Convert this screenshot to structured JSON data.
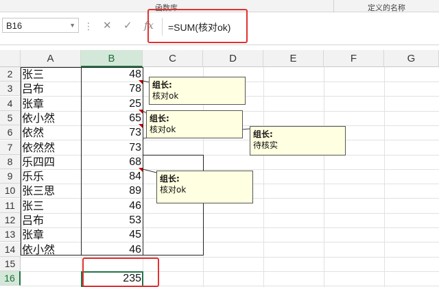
{
  "ribbon": {
    "group_functions": "函数库",
    "group_names": "定义的名称"
  },
  "namebox": {
    "value": "B16"
  },
  "formula": {
    "text": "=SUM(核对ok)",
    "fx_symbol": "fx",
    "cancel_symbol": "✕",
    "enter_symbol": "✓"
  },
  "columns": [
    "A",
    "B",
    "C",
    "D",
    "E",
    "F",
    "G"
  ],
  "rows": [
    {
      "num": "2",
      "name": "张三",
      "value": "48"
    },
    {
      "num": "3",
      "name": "吕布",
      "value": "78"
    },
    {
      "num": "4",
      "name": "张章",
      "value": "25"
    },
    {
      "num": "5",
      "name": "依小然",
      "value": "65"
    },
    {
      "num": "6",
      "name": "依然",
      "value": "73"
    },
    {
      "num": "7",
      "name": "依然然",
      "value": "73"
    },
    {
      "num": "8",
      "name": "乐四四",
      "value": "68"
    },
    {
      "num": "9",
      "name": "乐乐",
      "value": "84"
    },
    {
      "num": "10",
      "name": "张三思",
      "value": "89"
    },
    {
      "num": "11",
      "name": "张三",
      "value": "46"
    },
    {
      "num": "12",
      "name": "吕布",
      "value": "53"
    },
    {
      "num": "13",
      "name": "张章",
      "value": "45"
    },
    {
      "num": "14",
      "name": "依小然",
      "value": "46"
    },
    {
      "num": "15",
      "name": "",
      "value": ""
    },
    {
      "num": "16",
      "name": "",
      "value": "235"
    }
  ],
  "comments": [
    {
      "author": "组长:",
      "text": "核对ok"
    },
    {
      "author": "组长:",
      "text": "核对ok"
    },
    {
      "author": "组长:",
      "text": "待核实"
    },
    {
      "author": "组长:",
      "text": "核对ok"
    }
  ],
  "colors": {
    "accent": "#217346",
    "highlight": "#e03030",
    "comment_bg": "#ffffe1",
    "comment_marker": "#c00000"
  }
}
